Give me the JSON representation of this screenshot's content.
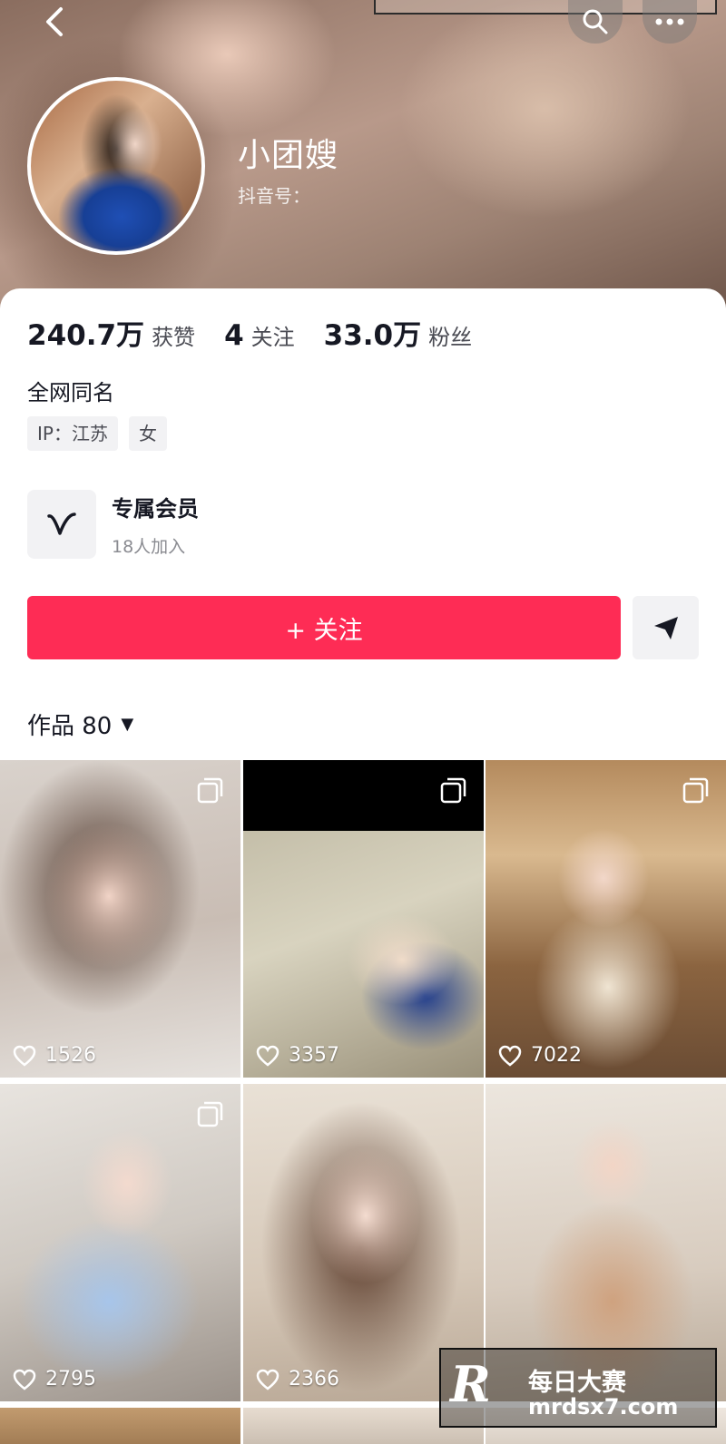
{
  "profile": {
    "name": "小团嫂",
    "douyin_id_label": "抖音号：",
    "bio": "全网同名",
    "tags": [
      "IP：江苏",
      "女"
    ]
  },
  "stats": [
    {
      "value": "240.7万",
      "label": "获赞"
    },
    {
      "value": "4",
      "label": "关注"
    },
    {
      "value": "33.0万",
      "label": "粉丝"
    }
  ],
  "membership": {
    "title": "专属会员",
    "subtitle": "18人加入"
  },
  "actions": {
    "follow_label": "+ 关注"
  },
  "works": {
    "tab_label": "作品 80",
    "items": [
      {
        "likes": "1526",
        "multi_image": true
      },
      {
        "likes": "3357",
        "multi_image": true
      },
      {
        "likes": "7022",
        "multi_image": true
      },
      {
        "likes": "2795",
        "multi_image": true
      },
      {
        "likes": "2366",
        "multi_image": false
      },
      {
        "likes": "",
        "multi_image": false
      }
    ]
  },
  "watermark": {
    "logo": "R",
    "title": "每日大赛",
    "url": "mrdsx7.com"
  },
  "colors": {
    "follow_button": "#fe2c55",
    "text_primary": "#161823",
    "text_secondary": "#8a8b91",
    "tag_background": "#f2f2f4"
  },
  "icons": [
    "back-arrow-icon",
    "search-icon",
    "more-icon",
    "vip-v-icon",
    "share-arrow-icon",
    "multi-image-icon",
    "heart-icon",
    "caret-down-icon"
  ]
}
